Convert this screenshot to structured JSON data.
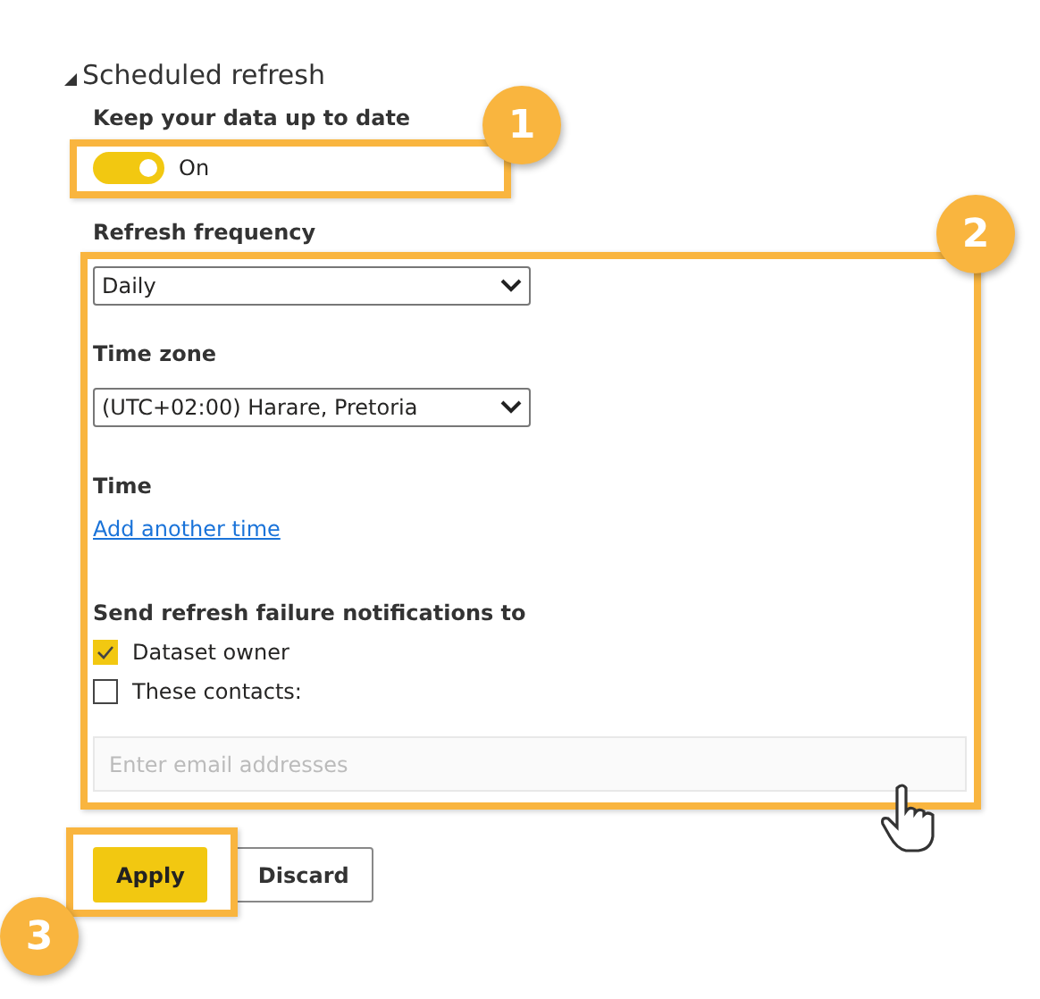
{
  "section": {
    "title": "Scheduled refresh",
    "expanded": true
  },
  "keep_up_to_date": {
    "label": "Keep your data up to date",
    "on": true,
    "state_text": "On"
  },
  "refresh_frequency": {
    "label": "Refresh frequency",
    "value": "Daily"
  },
  "time_zone": {
    "label": "Time zone",
    "value": "(UTC+02:00) Harare, Pretoria"
  },
  "time": {
    "label": "Time",
    "link": "Add another time"
  },
  "notifications": {
    "label": "Send refresh failure notifications to",
    "options": [
      {
        "label": "Dataset owner",
        "checked": true
      },
      {
        "label": "These contacts:",
        "checked": false
      }
    ],
    "email_placeholder": "Enter email addresses"
  },
  "buttons": [
    {
      "label": "Apply",
      "kind": "primary"
    },
    {
      "label": "Discard",
      "kind": "secondary"
    }
  ],
  "callouts": [
    {
      "number": "1"
    },
    {
      "number": "2"
    },
    {
      "number": "3"
    }
  ]
}
